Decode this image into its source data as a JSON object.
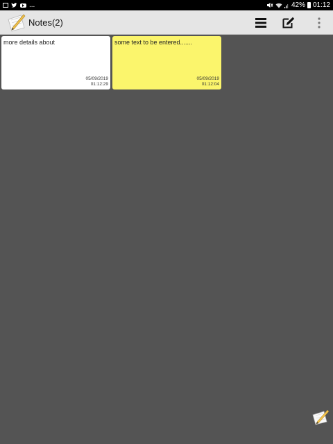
{
  "status_bar": {
    "left_extra": "...",
    "battery": "42%",
    "time": "01:12"
  },
  "app_bar": {
    "title": "Notes(2)"
  },
  "notes": [
    {
      "text": "more details about",
      "date": "05/09/2019",
      "time": "01:12:29",
      "color": "#ffffff"
    },
    {
      "text": "some text to be entered.......",
      "date": "05/09/2019",
      "time": "01:12:04",
      "color": "#fbf56c"
    }
  ],
  "icons": {
    "app_logo": "notepad-pencil-icon",
    "list_view": "list-view-icon",
    "new_note": "edit-note-icon",
    "more": "more-vert-icon",
    "fab": "new-note-icon"
  }
}
